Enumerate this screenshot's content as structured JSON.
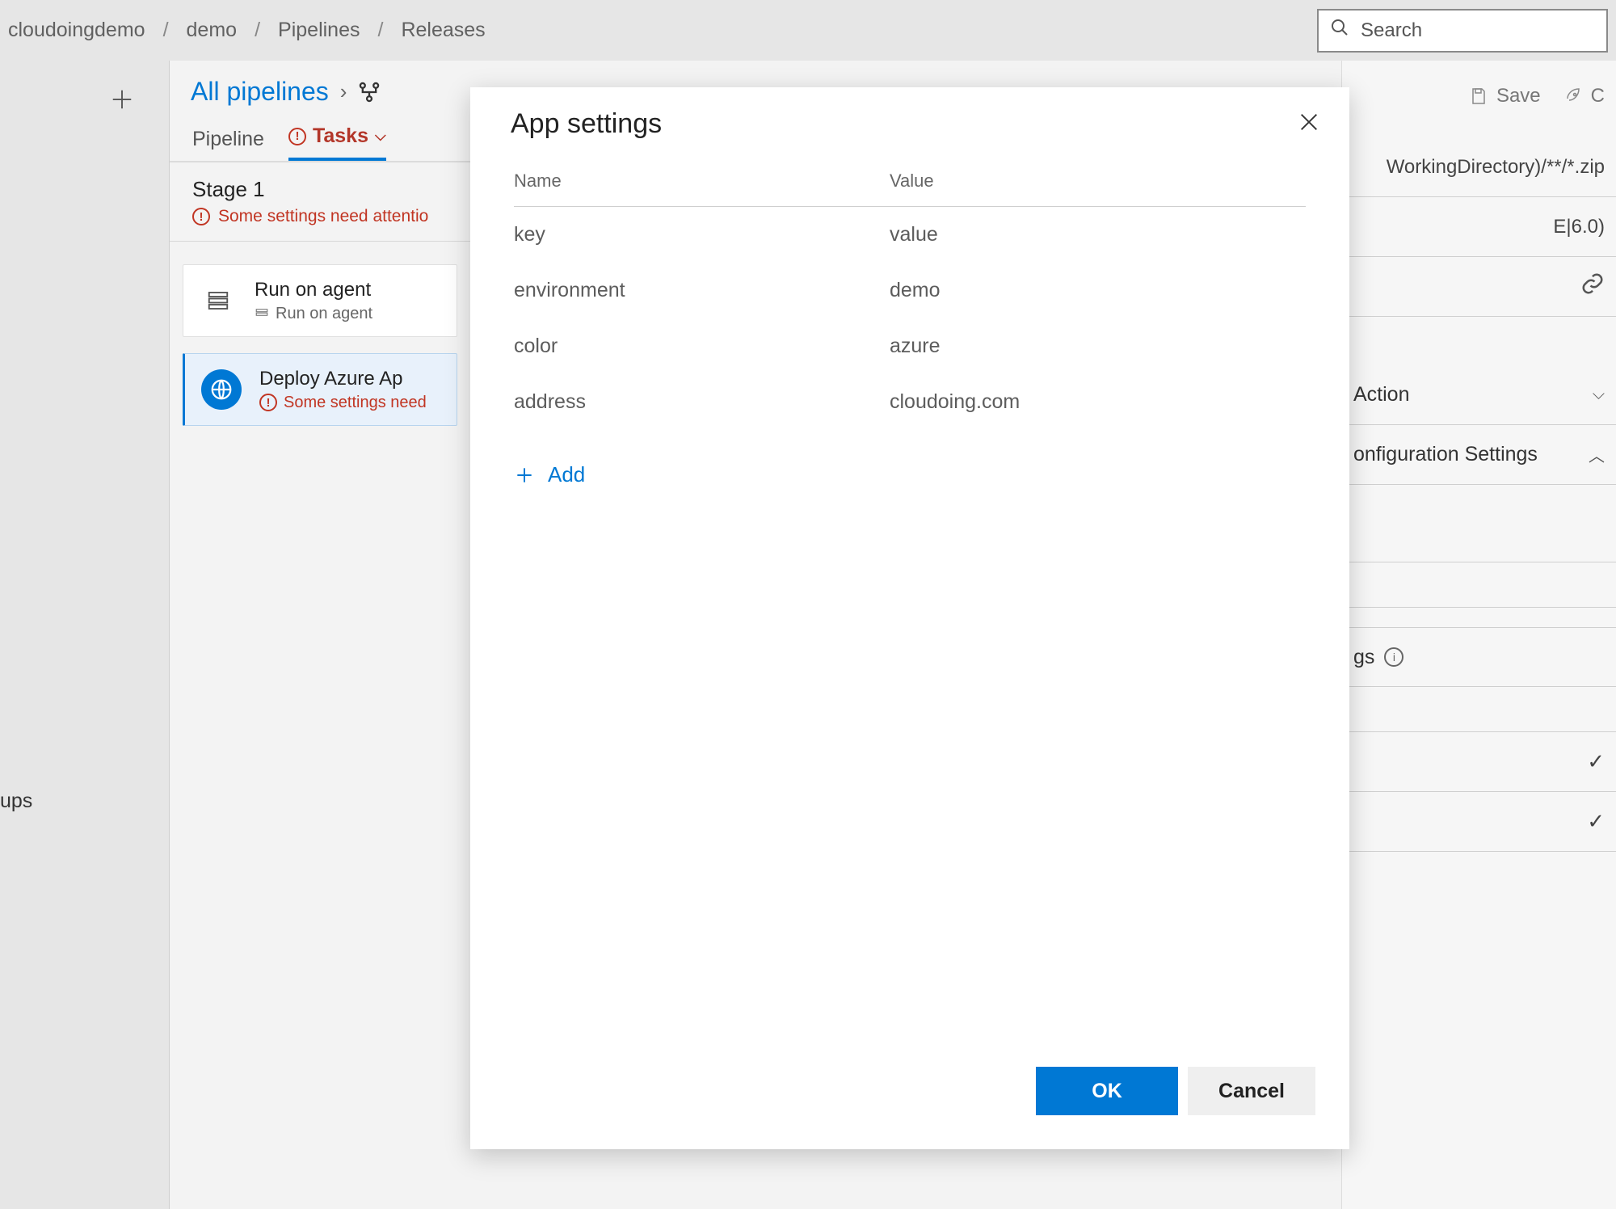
{
  "breadcrumb": {
    "org": "cloudoingdemo",
    "project": "demo",
    "section": "Pipelines",
    "page": "Releases"
  },
  "search": {
    "placeholder": "Search"
  },
  "header": {
    "allPipelines": "All pipelines",
    "save": "Save",
    "createRelease": "C"
  },
  "tabs": {
    "pipeline": "Pipeline",
    "tasks": "Tasks"
  },
  "stage": {
    "title": "Stage 1",
    "warning": "Some settings need attentio"
  },
  "tasks": [
    {
      "title": "Run on agent",
      "subtitle": "Run on agent"
    },
    {
      "title": "Deploy Azure Ap",
      "warning": "Some settings need"
    }
  ],
  "rightPanel": {
    "packagePath": "WorkingDirectory)/**/*.zip",
    "runtime": "E|6.0)",
    "action": "Action",
    "configSection": "onfiguration Settings",
    "appSettingsPartial": "gs"
  },
  "leftNav": {
    "cut": "ups"
  },
  "modal": {
    "title": "App settings",
    "columns": {
      "name": "Name",
      "value": "Value"
    },
    "rows": [
      {
        "name": "key",
        "value": "value"
      },
      {
        "name": "environment",
        "value": "demo"
      },
      {
        "name": "color",
        "value": "azure"
      },
      {
        "name": "address",
        "value": "cloudoing.com"
      }
    ],
    "add": "Add",
    "ok": "OK",
    "cancel": "Cancel"
  }
}
